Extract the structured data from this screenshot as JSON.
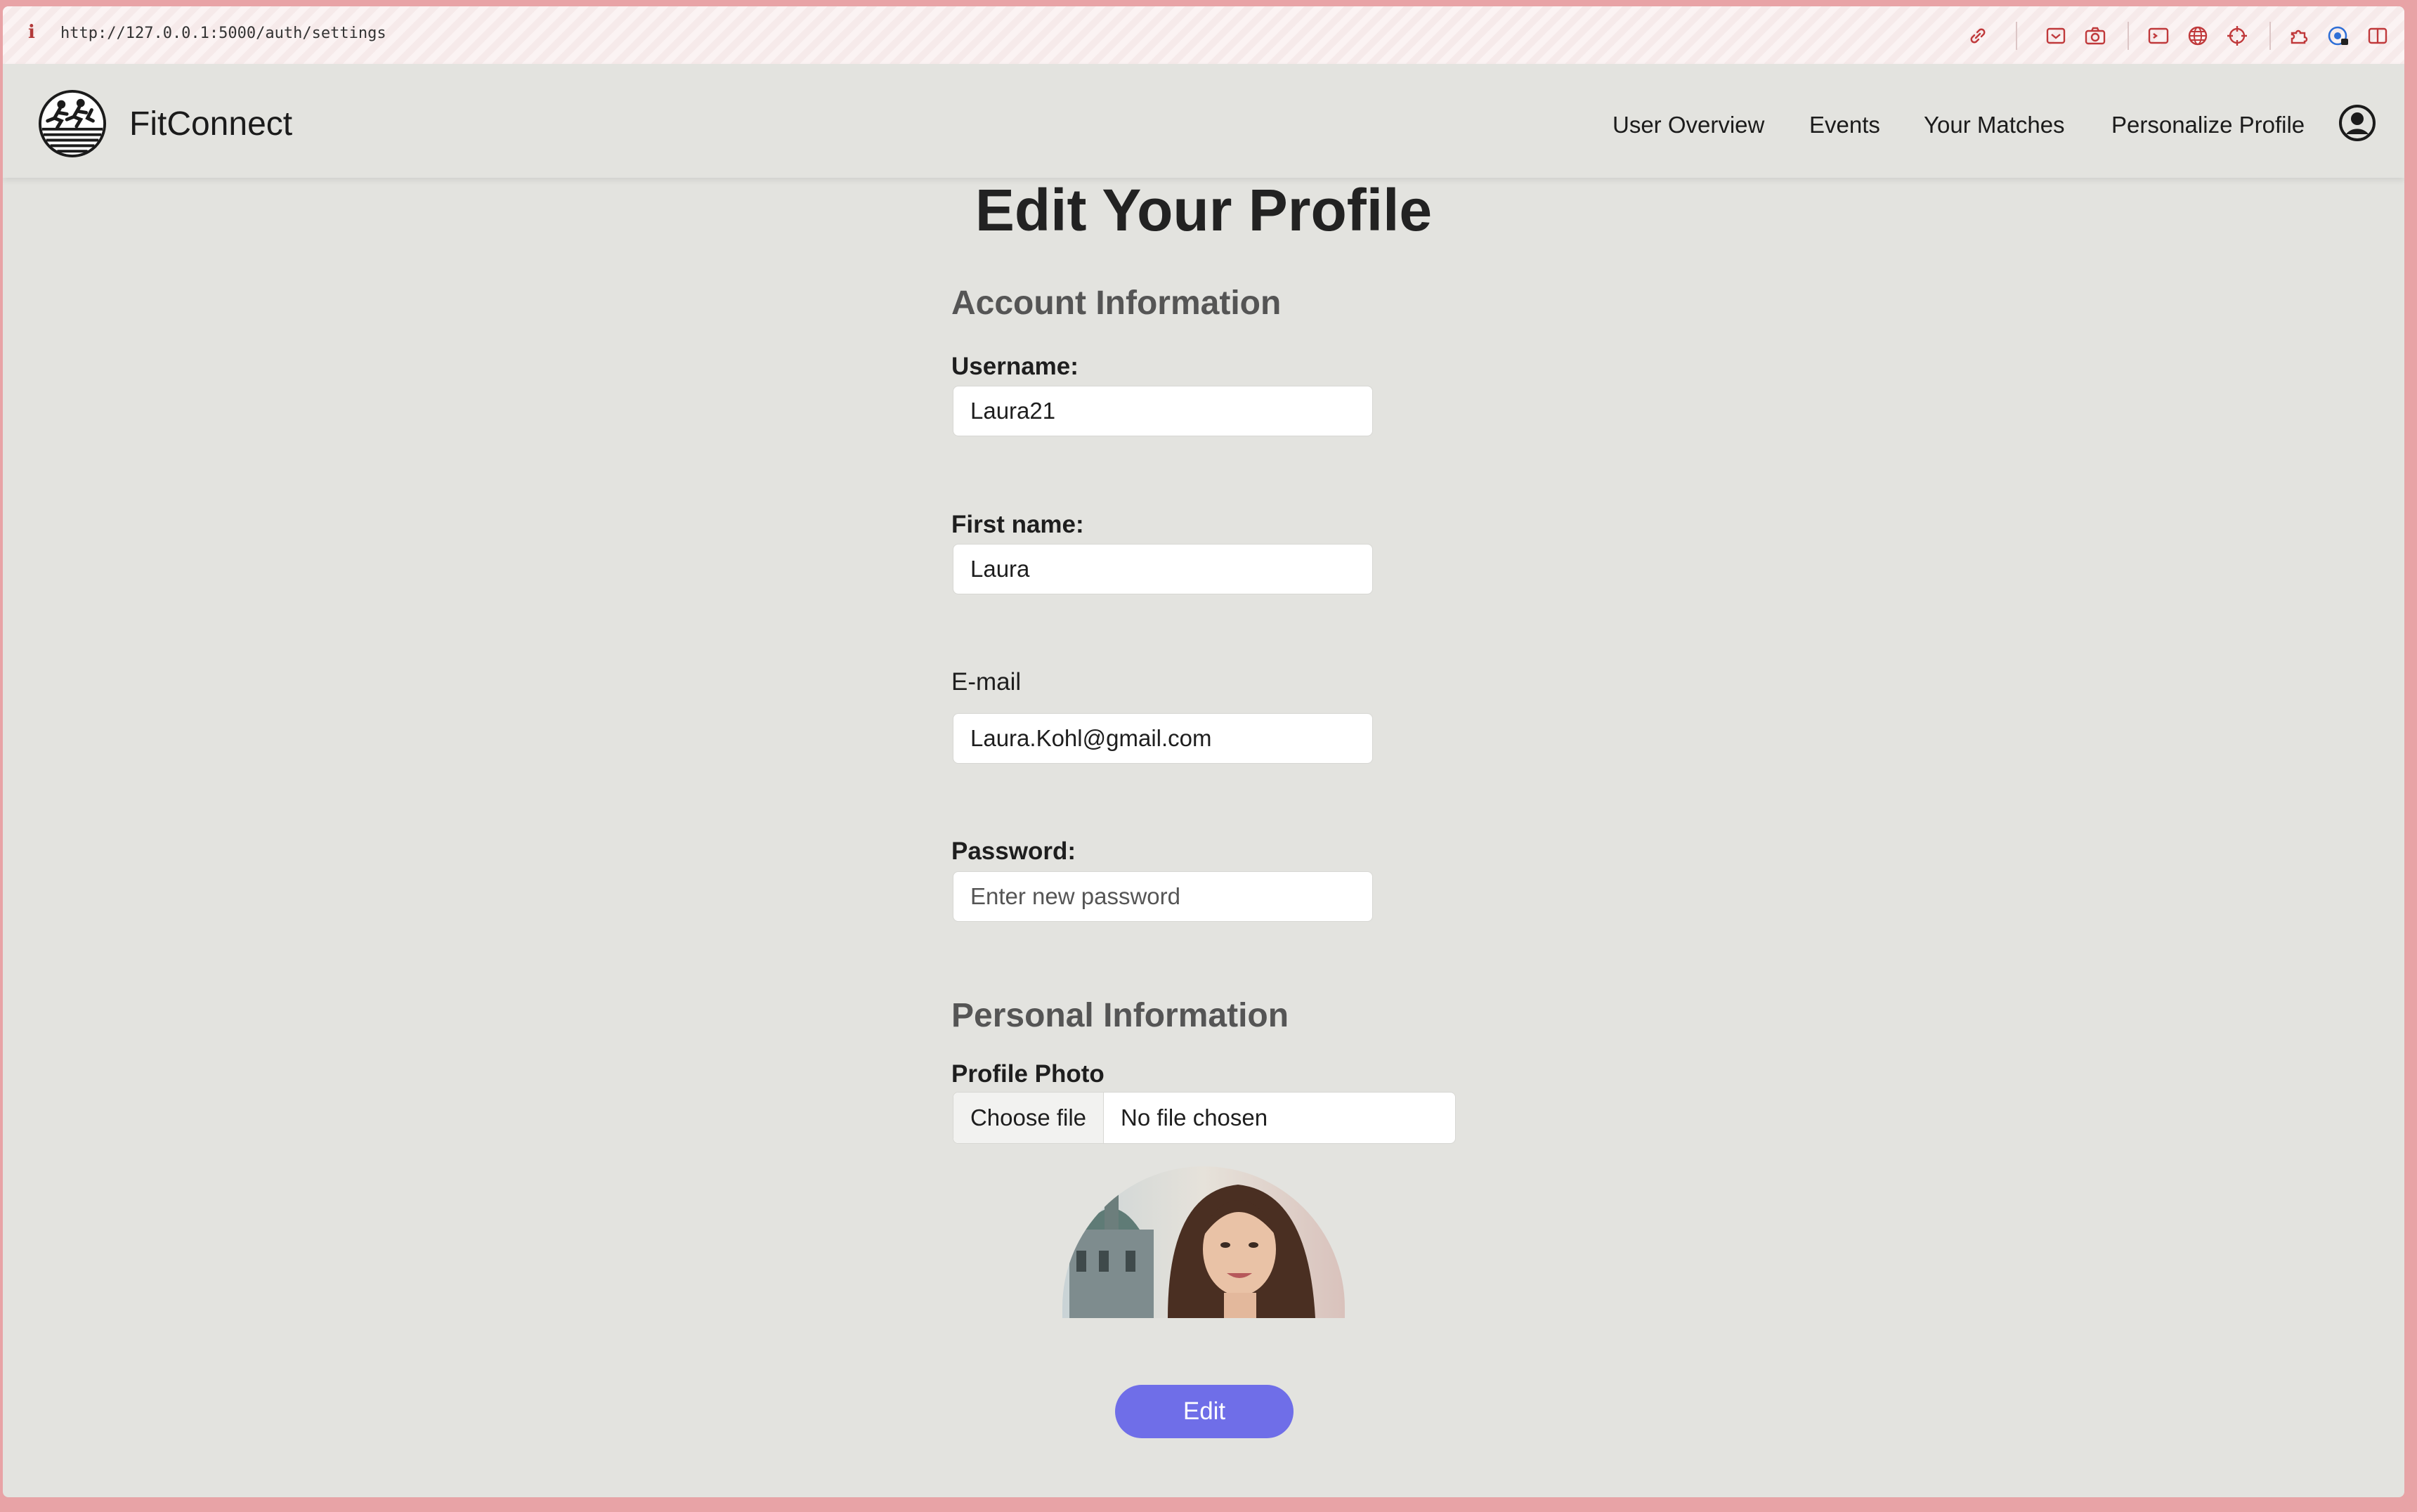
{
  "browser": {
    "info_icon": "i",
    "url": "http://127.0.0.1:5000/auth/settings",
    "toolbar_icons": [
      "link-icon",
      "pocket-icon",
      "screenshot-icon",
      "terminal-icon",
      "globe-icon",
      "crosshair-icon",
      "extensions-icon",
      "password-manager-icon",
      "sidebar-icon"
    ]
  },
  "navbar": {
    "brand": "FitConnect",
    "links": [
      "User Overview",
      "Events",
      "Your Matches",
      "Personalize Profile"
    ],
    "account_icon": "user-circle-icon"
  },
  "page": {
    "title": "Edit Your Profile",
    "account_section": "Account Information",
    "username_label": "Username:",
    "username_value": "Laura21",
    "firstname_label": "First name:",
    "firstname_value": "Laura",
    "email_label": "E-mail",
    "email_value": "Laura.Kohl@gmail.com",
    "password_label": "Password:",
    "password_placeholder": "Enter new password",
    "personal_section": "Personal Information",
    "photo_label": "Profile Photo",
    "file_button": "Choose file",
    "file_status": "No file chosen",
    "edit_button": "Edit"
  },
  "colors": {
    "accent": "#6f6ee8",
    "page_bg": "#e3e3df",
    "frame": "#e8a3a6"
  }
}
